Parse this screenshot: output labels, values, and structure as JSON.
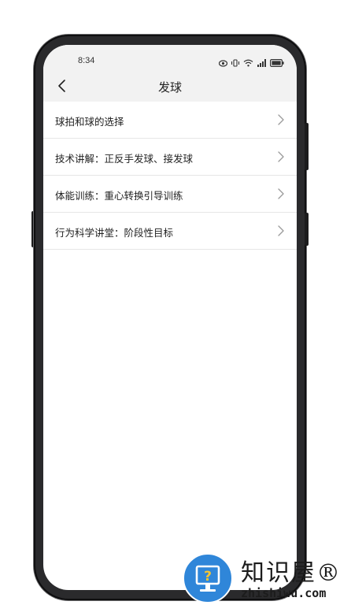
{
  "status_bar": {
    "time": "8:34",
    "icons": [
      "eye-icon",
      "vibrate-icon",
      "wifi-icon",
      "signal-icon",
      "battery-icon"
    ]
  },
  "nav": {
    "back_icon": "chevron-left-icon",
    "title": "发球"
  },
  "list": {
    "items": [
      {
        "label": "球拍和球的选择"
      },
      {
        "label": "技术讲解：正反手发球、接发球"
      },
      {
        "label": "体能训练：重心转换引导训练"
      },
      {
        "label": "行为科学讲堂：阶段性目标"
      }
    ],
    "chevron_icon": "chevron-right-icon"
  },
  "watermark": {
    "brand": "知识屋®",
    "domain": "zhishiwu.com"
  },
  "colors": {
    "header_bg": "#f2f2f2",
    "text": "#222222",
    "divider": "#e6e6e6",
    "watermark_blue": "#2f86d9"
  }
}
